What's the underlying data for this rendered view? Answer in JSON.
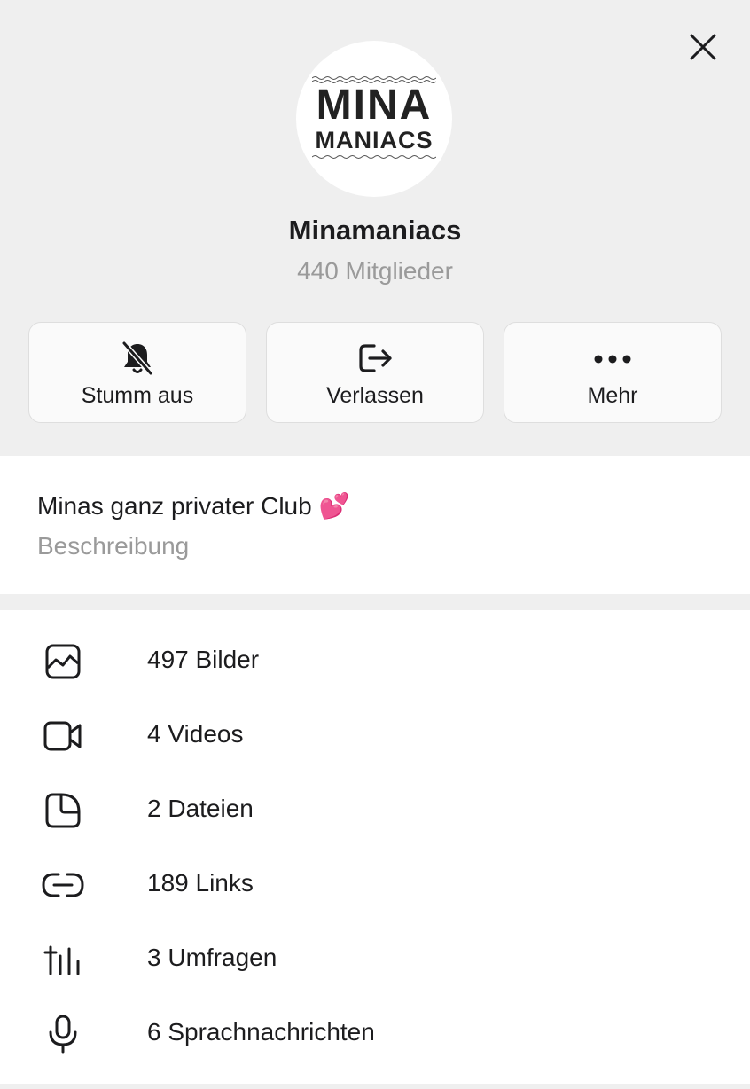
{
  "group": {
    "logo_line1": "MINA",
    "logo_line2": "MANIACS",
    "name": "Minamaniacs",
    "members": "440 Mitglieder"
  },
  "actions": [
    {
      "label": "Stumm aus",
      "icon": "bell-off-icon"
    },
    {
      "label": "Verlassen",
      "icon": "leave-icon"
    },
    {
      "label": "Mehr",
      "icon": "more-icon"
    }
  ],
  "description": {
    "text": "Minas ganz privater Club 💕",
    "label": "Beschreibung"
  },
  "media": [
    {
      "label": "497 Bilder",
      "icon": "image-icon"
    },
    {
      "label": "4 Videos",
      "icon": "video-icon"
    },
    {
      "label": "2 Dateien",
      "icon": "file-icon"
    },
    {
      "label": "189 Links",
      "icon": "link-icon"
    },
    {
      "label": "3 Umfragen",
      "icon": "poll-icon"
    },
    {
      "label": "6 Sprachnachrichten",
      "icon": "microphone-icon"
    }
  ],
  "colors": {
    "header_bg": "#efefef",
    "text_primary": "#1c1c1e",
    "text_secondary": "#9a9a9a"
  }
}
